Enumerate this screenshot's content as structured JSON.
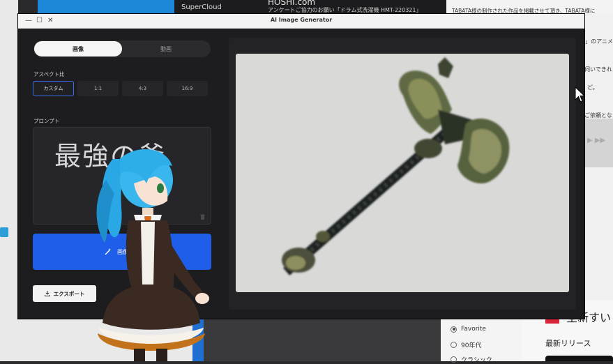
{
  "background": {
    "top_dark_label": "SuperCloud",
    "top_mid_title": "HOSHI.com",
    "top_mid_subtitle": "アンケートご協力のお願い「ドラム式洗濯機 HMT-220321」",
    "right_lines": [
      "TABATA様の制作された作品を掲載させて頂き、TABATA様に",
      "n」のアニメー",
      "伺いできれ",
      "ど。",
      "ご依頼となり"
    ],
    "radio_options": [
      {
        "label": "Favorite",
        "selected": true
      },
      {
        "label": "90年代",
        "selected": false
      },
      {
        "label": "クラシック",
        "selected": false
      }
    ],
    "bottom_right_big": "全新すい",
    "bottom_right_sub": "最新リリース",
    "media_controls": "▶ ▶▶"
  },
  "window": {
    "title": "AI Image Generator",
    "controls": {
      "minimize": "—",
      "maximize": "☐",
      "close": "✕"
    }
  },
  "mode_tabs": [
    {
      "label": "画像",
      "active": true
    },
    {
      "label": "動画",
      "active": false
    }
  ],
  "aspect": {
    "label": "アスペクト比",
    "options": [
      {
        "label": "カスタム",
        "selected": true
      },
      {
        "label": "1:1",
        "selected": false
      },
      {
        "label": "4:3",
        "selected": false
      },
      {
        "label": "16:9",
        "selected": false
      }
    ]
  },
  "prompt": {
    "label": "プロンプト",
    "value": "最強の斧"
  },
  "generate_button": {
    "label": "画像生成"
  },
  "export_button": {
    "label": "エクスポート"
  },
  "colors": {
    "accent_blue": "#1f5ee8",
    "window_bg": "#1d1d1f",
    "canvas_bg": "#d9d9d8"
  }
}
